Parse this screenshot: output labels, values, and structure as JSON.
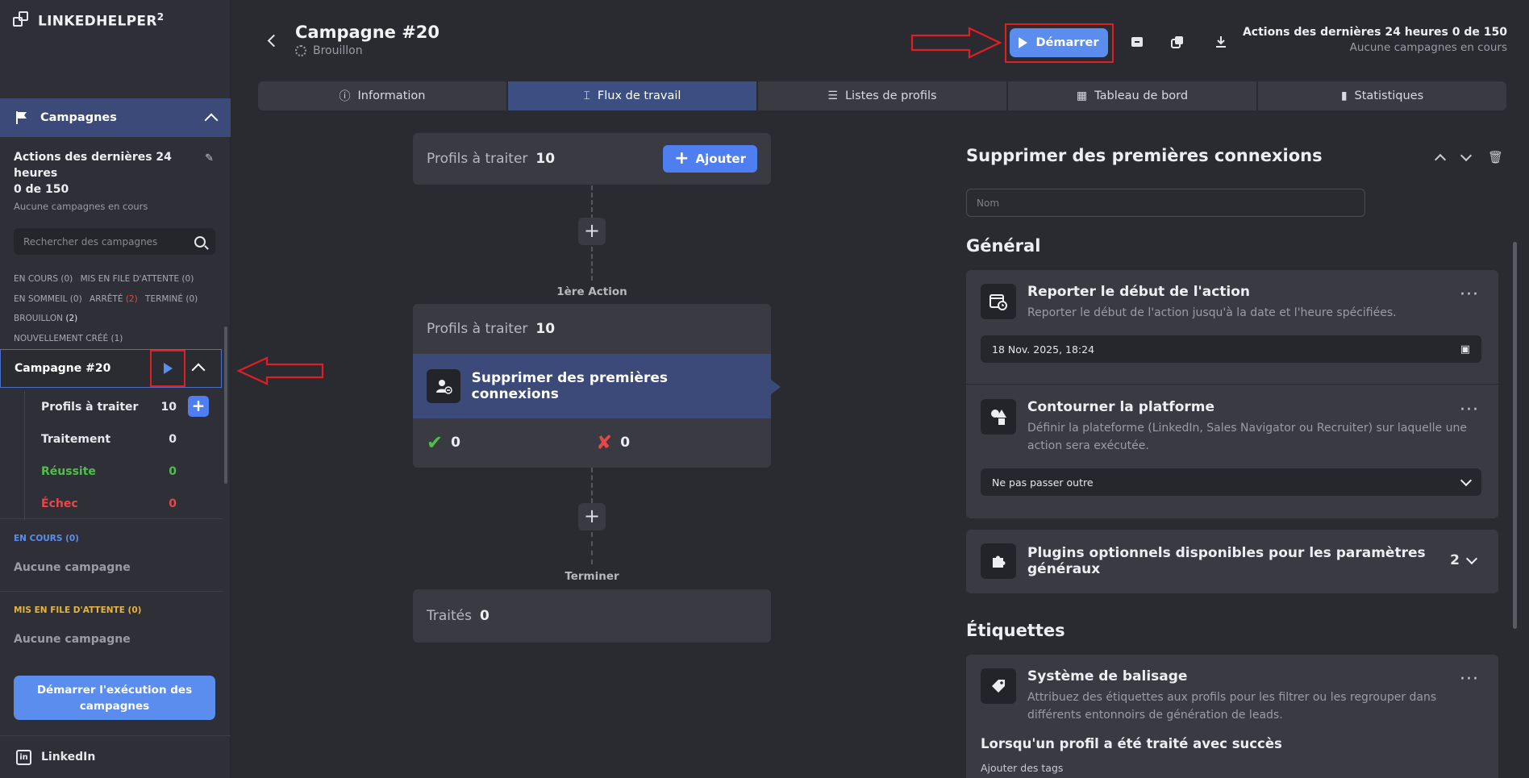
{
  "app": {
    "name": "LINKEDHELPER",
    "version_sup": "2"
  },
  "sidebar": {
    "section_title": "Campagnes",
    "actions_title": "Actions des dernières 24 heures",
    "actions_count": "0 de 150",
    "actions_sub": "Aucune campagnes en cours",
    "search_placeholder": "Rechercher des campagnes",
    "filters": {
      "en_cours": "EN COURS (0)",
      "en_attente": "MIS EN FILE D'ATTENTE (0)",
      "en_sommeil": "EN SOMMEIL (0)",
      "arrete_label": "ARRÊTÉ",
      "arrete_count": "(2)",
      "termine": "TERMINÉ (0)",
      "brouillon_label": "BROUILLON",
      "brouillon_count": "(2)",
      "nouvellement": "NOUVELLEMENT CRÉÉ (1)"
    },
    "campaign": {
      "name": "Campagne #20",
      "rows": [
        {
          "label": "Profils à traiter",
          "value": "10"
        },
        {
          "label": "Traitement",
          "value": "0"
        },
        {
          "label": "Réussite",
          "value": "0"
        },
        {
          "label": "Échec",
          "value": "0"
        }
      ]
    },
    "section_running": {
      "label": "EN COURS (0)",
      "empty": "Aucune campagne"
    },
    "section_queue": {
      "label": "MIS EN FILE D'ATTENTE (0)",
      "empty": "Aucune campagne"
    },
    "run_button": "Démarrer l'exécution des campagnes",
    "linkedin_label": "LinkedIn"
  },
  "header": {
    "title": "Campagne #20",
    "subtitle": "Brouillon",
    "start_button": "Démarrer",
    "stats_line1": "Actions des dernières 24 heures 0 de 150",
    "stats_line2": "Aucune campagnes en cours"
  },
  "tabs": [
    {
      "label": "Information",
      "icon": "info-icon"
    },
    {
      "label": "Flux de travail",
      "icon": "workflow-icon"
    },
    {
      "label": "Listes de profils",
      "icon": "list-icon"
    },
    {
      "label": "Tableau de bord",
      "icon": "dashboard-icon"
    },
    {
      "label": "Statistiques",
      "icon": "stats-icon"
    }
  ],
  "workflow": {
    "start_card": {
      "label": "Profils à traiter",
      "count": "10",
      "add_button": "Ajouter"
    },
    "first_action_label": "1ère Action",
    "action_card": {
      "label": "Profils à traiter",
      "count": "10",
      "action_name": "Supprimer des premières connexions",
      "success": "0",
      "fail": "0"
    },
    "end_label": "Terminer",
    "end_card": {
      "label": "Traités",
      "count": "0"
    }
  },
  "panel": {
    "title": "Supprimer des premières connexions",
    "name_placeholder": "Nom",
    "general_heading": "Général",
    "delay": {
      "title": "Reporter le début de l'action",
      "desc": "Reporter le début de l'action jusqu'à la date et l'heure spécifiées.",
      "value": "18 Nov. 2025, 18:24"
    },
    "bypass": {
      "title": "Contourner la platforme",
      "desc": "Définir la plateforme (LinkedIn, Sales Navigator ou Recruiter) sur laquelle une action sera exécutée.",
      "value": "Ne pas passer outre"
    },
    "plugins": {
      "title": "Plugins optionnels disponibles pour les paramètres généraux",
      "count": "2"
    },
    "tags_heading": "Étiquettes",
    "tagging": {
      "title": "Système de balisage",
      "desc": "Attribuez des étiquettes aux profils pour les filtrer ou les regrouper dans différents entonnoirs de génération de leads.",
      "success_heading": "Lorsqu'un profil a été traité avec succès",
      "add_tags": "Ajouter des tags"
    }
  },
  "colors": {
    "accent": "#5b8def",
    "active_nav": "#3b4a78",
    "success": "#4fbf4a",
    "danger": "#e8474a",
    "annotation": "#e01e24",
    "queue": "#e8b43a"
  }
}
